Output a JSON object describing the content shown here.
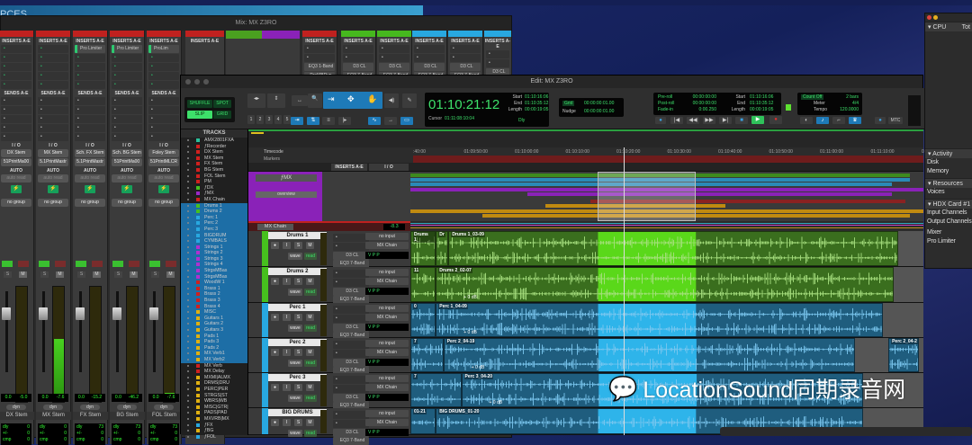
{
  "desktop": {
    "label": "PCES"
  },
  "mix_window": {
    "title": "Mix: MX Z3RO",
    "section_inserts": "INSERTS A-E",
    "section_sends": "SENDS A-E",
    "section_io": "I / O",
    "section_auto": "AUTO",
    "auto_mode": "auto read",
    "group": "no group",
    "strips": [
      {
        "name": "DX Stem",
        "color": "#c0211f",
        "insert": "",
        "out1": "DX Stem",
        "out2": "51PrintMa00",
        "vol": "0.0",
        "peak": "-5.0",
        "dly": "0",
        "level": 0.0
      },
      {
        "name": "MX Stem",
        "color": "#c0211f",
        "insert": "",
        "out1": "MX Stem",
        "out2": "5.1PrintMastr",
        "vol": "0.0",
        "peak": "-7.6",
        "dly": "0",
        "level": 0.55
      },
      {
        "name": "FX Stem",
        "color": "#c0211f",
        "insert": "Pro Limiter",
        "out1": "Sch. FX Stem",
        "out2": "5.1PrintMastr",
        "vol": "0.0",
        "peak": "-15.2",
        "dly": "73",
        "level": 0.0
      },
      {
        "name": "BG Stem",
        "color": "#c0211f",
        "insert": "Pro Limiter",
        "out1": "Sch. BG Stem",
        "out2": "51PrintMa00",
        "vol": "0.0",
        "peak": "-46.2",
        "dly": "73",
        "level": 0.0
      },
      {
        "name": "FOL Stem",
        "color": "#c0211f",
        "insert": "ProLim",
        "out1": "Foley Stem",
        "out2": "51PrintMLCR",
        "vol": "0.0",
        "peak": "-7.6",
        "dly": "73",
        "level": 0.08
      }
    ],
    "dly_labels": [
      "dly",
      "+/-",
      "cmp"
    ],
    "dyn_label": "dyn",
    "upper_strips": [
      {
        "color": "#c0211f",
        "inserts": [
          "EQ3 1-Band",
          "ProMBDyn"
        ]
      },
      {
        "color": "#46b81e",
        "inserts": [
          "D3 CL",
          "EQ3 7-Band"
        ]
      },
      {
        "color": "#46b81e",
        "inserts": [
          "D3 CL",
          "EQ3 7-Band"
        ]
      },
      {
        "color": "#28a8e0",
        "inserts": [
          "D3 CL",
          "EQ3 7-Band"
        ]
      },
      {
        "color": "#28a8e0",
        "inserts": [
          "D3 CL",
          "EQ3 7-Band"
        ]
      },
      {
        "color": "#28a8e0",
        "inserts": [
          "D3 CL",
          "EQ3 7-Band"
        ]
      }
    ]
  },
  "edit_window": {
    "title": "Edit: MX Z3RO",
    "modes": {
      "shuffle": "SHUFFLE",
      "spot": "SPOT",
      "slip": "SLIP",
      "grid": "GRID"
    },
    "zoom_presets": [
      "1",
      "2",
      "3",
      "4",
      "5"
    ],
    "main_counter": "01:10:21:12",
    "cursor_label": "Cursor",
    "cursor_value": "01:11:08:10:04",
    "selection": {
      "start_label": "Start",
      "end_label": "End",
      "length_label": "Length",
      "start": "01:10:16:06",
      "end": "01:10:35:12",
      "length": "00:00:19:05"
    },
    "grid": {
      "grid_label": "Grid",
      "grid_value": "00:00:00:01.00",
      "nudge_label": "Nudge",
      "nudge_value": "00:00:00:01.00"
    },
    "transport": {
      "preroll_label": "Pre-roll",
      "preroll": "00:00:00:00",
      "postroll_label": "Post-roll",
      "postroll": "00:00:00:00",
      "fadein_label": "Fade-in",
      "fadein": "0:00.250",
      "start_label": "Start",
      "start": "01:10:16:06",
      "end_label": "End",
      "end": "01:10:35:12",
      "length_label": "Length",
      "length": "00:00:19:05"
    },
    "midi": {
      "countoff": "Count Off",
      "bars": "2 bars",
      "meter_label": "Meter",
      "meter": "4/4",
      "tempo_label": "Tempo",
      "tempo": "120.0000"
    },
    "mtc_label": "MTC",
    "dly_label": "Dly",
    "tracks_header": "TRACKS",
    "track_list": [
      {
        "name": "AMX2801FXA",
        "color": "#2bbf9a",
        "sel": false
      },
      {
        "name": "ƒRecorder",
        "color": "#d0201e",
        "sel": false
      },
      {
        "name": "DX Stem",
        "color": "#d0201e",
        "sel": false
      },
      {
        "name": "MX Stem",
        "color": "#d0201e",
        "sel": false
      },
      {
        "name": "FX Stem",
        "color": "#d0201e",
        "sel": false
      },
      {
        "name": "BG Stem",
        "color": "#d0201e",
        "sel": false
      },
      {
        "name": "FOL Stem",
        "color": "#d0201e",
        "sel": false
      },
      {
        "name": "PM",
        "color": "#d0201e",
        "sel": false
      },
      {
        "name": "ƒDX",
        "color": "#46c01e",
        "sel": false
      },
      {
        "name": "ƒMX",
        "color": "#9a28c8",
        "sel": false
      },
      {
        "name": "MX Chain",
        "color": "#d0201e",
        "sel": false
      },
      {
        "name": "Drums 1",
        "color": "#46c01e",
        "sel": true
      },
      {
        "name": "Drums 2",
        "color": "#46c01e",
        "sel": true
      },
      {
        "name": "Perc 1",
        "color": "#28a8e0",
        "sel": true
      },
      {
        "name": "Perc 2",
        "color": "#28a8e0",
        "sel": true
      },
      {
        "name": "Perc 3",
        "color": "#28a8e0",
        "sel": true
      },
      {
        "name": "BIGDRUM",
        "color": "#28a8e0",
        "sel": true
      },
      {
        "name": "CYMBALS",
        "color": "#28a8e0",
        "sel": true
      },
      {
        "name": "Strings 1",
        "color": "#b030d0",
        "sel": true
      },
      {
        "name": "Strings 2",
        "color": "#b030d0",
        "sel": true
      },
      {
        "name": "Strings 3",
        "color": "#b030d0",
        "sel": true
      },
      {
        "name": "Strings 4",
        "color": "#b030d0",
        "sel": true
      },
      {
        "name": "StrgsMBas",
        "color": "#b030d0",
        "sel": true
      },
      {
        "name": "StrgsMBas",
        "color": "#b030d0",
        "sel": true
      },
      {
        "name": "WoodW 1",
        "color": "#d0201e",
        "sel": true
      },
      {
        "name": "Brass 1",
        "color": "#d0201e",
        "sel": true
      },
      {
        "name": "Brass 2",
        "color": "#d0201e",
        "sel": true
      },
      {
        "name": "Brass 3",
        "color": "#d0201e",
        "sel": true
      },
      {
        "name": "Brass 4",
        "color": "#d0201e",
        "sel": true
      },
      {
        "name": "MISC",
        "color": "#e0b010",
        "sel": true
      },
      {
        "name": "Guitars 1",
        "color": "#e0b010",
        "sel": true
      },
      {
        "name": "Guitars 2",
        "color": "#e0b010",
        "sel": true
      },
      {
        "name": "Guitars 3",
        "color": "#e0b010",
        "sel": true
      },
      {
        "name": "Pads 1",
        "color": "#e0b010",
        "sel": true
      },
      {
        "name": "Pads 3",
        "color": "#e0b010",
        "sel": true
      },
      {
        "name": "Pads 2",
        "color": "#e0b010",
        "sel": true
      },
      {
        "name": "MX Verb1",
        "color": "#e0b010",
        "sel": true
      },
      {
        "name": "MX Verb2",
        "color": "#e0b010",
        "sel": true
      },
      {
        "name": "MX Verb",
        "color": "#d0201e",
        "sel": false
      },
      {
        "name": "MX Delay",
        "color": "#d0201e",
        "sel": false
      },
      {
        "name": "MXMI|ALMX",
        "color": "#e0b010",
        "sel": false
      },
      {
        "name": "DRMS|DRU",
        "color": "#e0b010",
        "sel": false
      },
      {
        "name": "PERC|PER",
        "color": "#e0b010",
        "sel": false
      },
      {
        "name": "STRGS|ST",
        "color": "#e0b010",
        "sel": false
      },
      {
        "name": "WBRS|WB",
        "color": "#e0b010",
        "sel": false
      },
      {
        "name": "MISC|GTR|",
        "color": "#e0b010",
        "sel": false
      },
      {
        "name": "PADS|PAD",
        "color": "#e0b010",
        "sel": false
      },
      {
        "name": "MXVRB|MX",
        "color": "#e0b010",
        "sel": false
      },
      {
        "name": "ƒFX",
        "color": "#28a8e0",
        "sel": false
      },
      {
        "name": "ƒBG",
        "color": "#e0b010",
        "sel": false
      },
      {
        "name": "ƒFOL",
        "color": "#28a8e0",
        "sel": false
      }
    ],
    "rulers": {
      "timecode": "Timecode",
      "markers": "Markers"
    },
    "column_headers": {
      "inserts": "INSERTS A-E",
      "io": "I / O"
    },
    "ruler_ticks": [
      ":40:00",
      "01:09:50:00",
      "01:10:00:00",
      "01:10:10:00",
      "01:10:20:00",
      "01:10:30:00",
      "01:10:40:00",
      "01:10:50:00",
      "01:11:00:00",
      "01:11:10:00",
      "01:11"
    ],
    "folder": {
      "name": "ƒMX",
      "overview_label": "overview",
      "color": "#8a22b8"
    },
    "chain": {
      "name": "MX Chain",
      "value": "-8.3",
      "color": "#c0211f"
    },
    "button_labels": {
      "solo": "S",
      "mute": "M",
      "input": "I",
      "wave": "wave",
      "read": "read",
      "v": "V",
      "p": "P"
    },
    "tracks": [
      {
        "name": "Drums 1",
        "color": "#46c01e",
        "input": "no input",
        "output": "MX Chain",
        "ins1": "D3 CL",
        "ins2": "EQ3 7-Band",
        "clips": [
          {
            "name": "Drums 1_",
            "x0": 0,
            "x1": 0.05,
            "sel": false
          },
          {
            "name": "Dr",
            "x0": 0.05,
            "x1": 0.075,
            "sel": false
          },
          {
            "name": "Drums 1_03-09",
            "x0": 0.075,
            "x1": 0.96,
            "sel": true
          }
        ],
        "gain": ""
      },
      {
        "name": "Drums 2",
        "color": "#46c01e",
        "input": "no input",
        "output": "MX Chain",
        "ins1": "D3 CL",
        "ins2": "EQ3 7-Band",
        "clips": [
          {
            "name": "11",
            "x0": 0,
            "x1": 0.05,
            "sel": false
          },
          {
            "name": "Drums 2_02-07",
            "x0": 0.05,
            "x1": 0.95,
            "sel": true
          }
        ],
        "gain": "+ 0 dB"
      },
      {
        "name": "Perc 1",
        "color": "#28a8e0",
        "input": "no input",
        "output": "MX Chain",
        "ins1": "D3 CL",
        "ins2": "EQ3 7-Band",
        "clips": [
          {
            "name": "0",
            "x0": 0,
            "x1": 0.05,
            "sel": false
          },
          {
            "name": "Perc 1_04-09",
            "x0": 0.05,
            "x1": 0.93,
            "sel": true
          }
        ],
        "gain": "+ 0 dB"
      },
      {
        "name": "Perc 2",
        "color": "#28a8e0",
        "input": "no input",
        "output": "MX Chain",
        "ins1": "D3 CL",
        "ins2": "EQ3 7-Band",
        "clips": [
          {
            "name": "7",
            "x0": 0,
            "x1": 0.065,
            "sel": false
          },
          {
            "name": "Perc 2_04-19",
            "x0": 0.065,
            "x1": 0.875,
            "sel": true
          },
          {
            "name": "Perc 2_04-2",
            "x0": 0.94,
            "x1": 1.0,
            "sel": false
          }
        ],
        "gain": "+ 0 dB"
      },
      {
        "name": "Perc 3",
        "color": "#28a8e0",
        "input": "no input",
        "output": "MX Chain",
        "ins1": "D3 CL",
        "ins2": "EQ3 7-Band",
        "clips": [
          {
            "name": "7",
            "x0": 0,
            "x1": 0.1,
            "sel": false
          },
          {
            "name": "Perc 3_04-20",
            "x0": 0.1,
            "x1": 0.89,
            "sel": true
          }
        ],
        "gain": "+ 0 dB"
      },
      {
        "name": "BIG DRUMS",
        "color": "#28a8e0",
        "input": "no input",
        "output": "MX Chain",
        "ins1": "D3 CL",
        "ins2": "EQ3 7-Band",
        "clips": [
          {
            "name": "01-21",
            "x0": 0,
            "x1": 0.05,
            "sel": false
          },
          {
            "name": "BIG DRUMS_01-20",
            "x0": 0.05,
            "x1": 0.89,
            "sel": true
          }
        ],
        "gain": ""
      }
    ],
    "selection_range": {
      "start_s": 16.25,
      "end_s": 35.5,
      "playhead_s": 21.5
    }
  },
  "system_usage": {
    "cpu": "CPU",
    "total": "Tot",
    "activity": "Activity",
    "activity_rows": [
      "Disk",
      "Memory"
    ],
    "resources": "Resources",
    "resources_rows": [
      "Voices"
    ],
    "hdx": "HDX Card #1",
    "hdx_rows": [
      "Input Channels",
      "Output Channels",
      "Mixer",
      "Pro Limiter"
    ]
  },
  "watermark": "LocationSound同期录音网"
}
